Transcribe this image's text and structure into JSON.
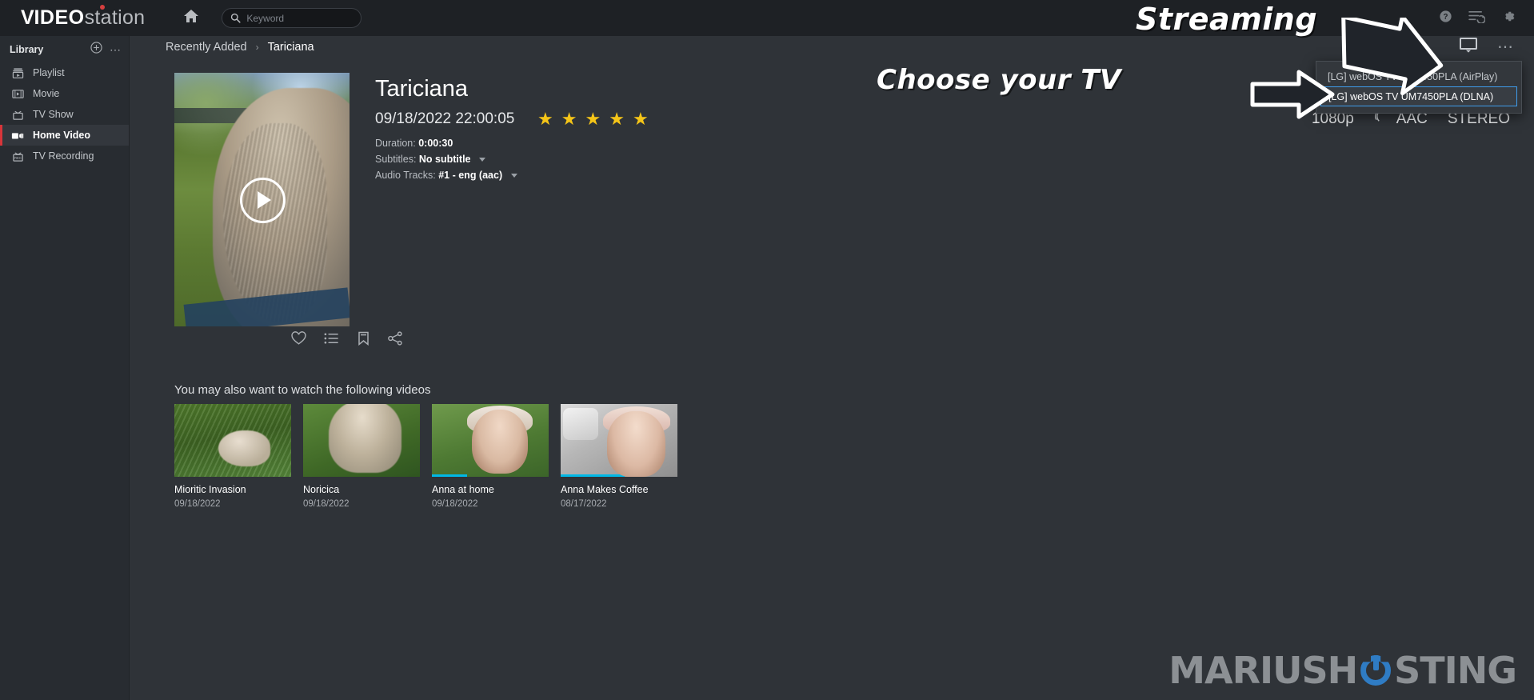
{
  "app": {
    "logo_v": "V",
    "logo_ideo": "IDEO",
    "logo_station": "station"
  },
  "topbar": {
    "home_icon": "home-icon",
    "search": {
      "placeholder": "Keyword",
      "value": "",
      "icon": "search-icon"
    },
    "icons": [
      "help-icon",
      "notifications-icon",
      "settings-icon"
    ]
  },
  "sidebar": {
    "title": "Library",
    "add_label": "+",
    "more_label": "⋯",
    "items": [
      {
        "label": "Playlist",
        "icon": "playlist-icon",
        "active": false
      },
      {
        "label": "Movie",
        "icon": "movie-icon",
        "active": false
      },
      {
        "label": "TV Show",
        "icon": "tv-show-icon",
        "active": false
      },
      {
        "label": "Home Video",
        "icon": "home-video-icon",
        "active": true
      },
      {
        "label": "TV Recording",
        "icon": "tv-recording-icon",
        "active": false
      }
    ]
  },
  "breadcrumb": {
    "parent": "Recently Added",
    "separator": "›",
    "current": "Tariciana"
  },
  "detail": {
    "title": "Tariciana",
    "datetime": "09/18/2022 22:00:05",
    "rating": 5,
    "rating_max": 5,
    "star_glyph": "★",
    "duration_label": "Duration:",
    "duration_value": "0:00:30",
    "subtitles_label": "Subtitles:",
    "subtitles_value": "No subtitle",
    "audio_label": "Audio Tracks:",
    "audio_value": "#1 - eng (aac)",
    "play_button": "play-button",
    "actions": [
      "favorite-icon",
      "add-to-playlist-icon",
      "bookmark-icon",
      "share-icon"
    ]
  },
  "badges": {
    "resolution": "1080p",
    "codec": "AAC",
    "channels": "STEREO"
  },
  "cast_menu": {
    "cast_icon": "cast-icon",
    "more_icon": "more-options-icon",
    "options": [
      {
        "label": "[LG] webOS TV UM7450PLA (AirPlay)",
        "selected": false
      },
      {
        "label": "[LG] webOS TV UM7450PLA (DLNA)",
        "selected": true
      }
    ],
    "highlight_color": "#3e9bea"
  },
  "related": {
    "heading": "You may also want to watch the following videos",
    "items": [
      {
        "name": "Mioritic Invasion",
        "date": "09/18/2022",
        "progress": 0
      },
      {
        "name": "Noricica",
        "date": "09/18/2022",
        "progress": 0
      },
      {
        "name": "Anna at home",
        "date": "09/18/2022",
        "progress": 30
      },
      {
        "name": "Anna Makes Coffee",
        "date": "08/17/2022",
        "progress": 55
      }
    ]
  },
  "annotations": {
    "streaming": "Streaming",
    "choose_tv": "Choose your TV"
  },
  "watermark": {
    "left": "MARIUSH",
    "right": "STING",
    "accent": "#2f7cc4"
  }
}
